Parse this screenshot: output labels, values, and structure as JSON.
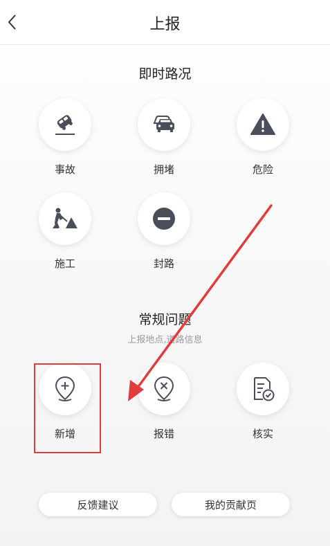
{
  "header": {
    "title": "上报",
    "back_icon": "chevron-left-icon"
  },
  "realtime": {
    "title": "即时路况",
    "items": [
      {
        "label": "事故",
        "icon": "car-accident-icon"
      },
      {
        "label": "拥堵",
        "icon": "traffic-jam-icon"
      },
      {
        "label": "危险",
        "icon": "warning-triangle-icon"
      },
      {
        "label": "施工",
        "icon": "construction-icon"
      },
      {
        "label": "封路",
        "icon": "road-closed-icon"
      }
    ]
  },
  "regular": {
    "title": "常规问题",
    "subtitle": "上报地点,道路信息",
    "items": [
      {
        "label": "新增",
        "icon": "add-location-icon"
      },
      {
        "label": "报错",
        "icon": "error-location-icon"
      },
      {
        "label": "核实",
        "icon": "verify-document-icon"
      }
    ]
  },
  "footer": {
    "feedback_label": "反馈建议",
    "contribution_label": "我的贡献页"
  },
  "colors": {
    "icon": "#4a4e5a",
    "annotation": "#e23b3b"
  }
}
